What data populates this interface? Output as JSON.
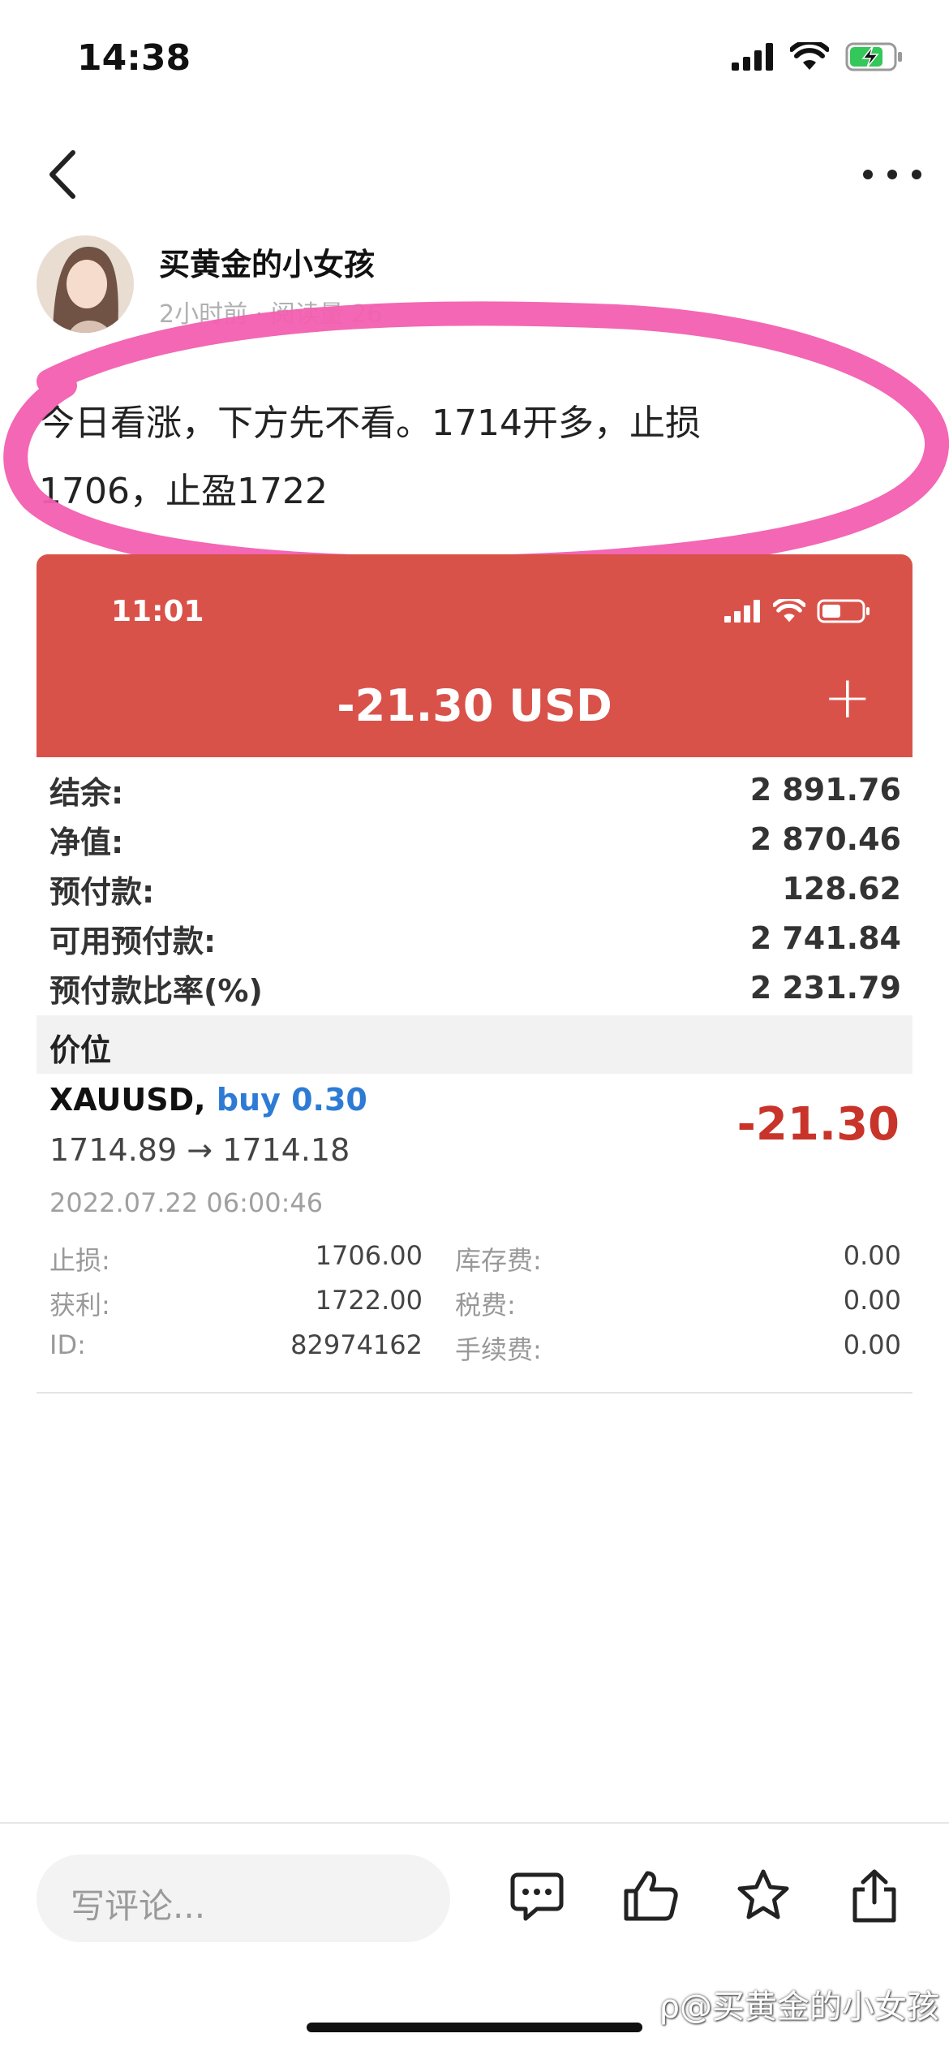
{
  "status_bar": {
    "time": "14:38"
  },
  "author": {
    "name": "买黄金的小女孩",
    "meta": "2小时前 · 阅读量 26"
  },
  "post": {
    "line1": "今日看涨，下方先不看。1714开多，止损",
    "line2": "1706，止盈1722"
  },
  "trade_screenshot": {
    "status_time": "11:01",
    "header_total": "-21.30 USD",
    "plus_label": "+",
    "account": [
      {
        "label": "结余:",
        "value": "2 891.76"
      },
      {
        "label": "净值:",
        "value": "2 870.46"
      },
      {
        "label": "预付款:",
        "value": "128.62"
      },
      {
        "label": "可用预付款:",
        "value": "2 741.84"
      },
      {
        "label": "预付款比率(%)",
        "value": "2 231.79"
      }
    ],
    "section_label": "价位",
    "position": {
      "symbol": "XAUUSD,",
      "side": "buy 0.30",
      "prices": "1714.89 → 1714.18",
      "pl": "-21.30",
      "time": "2022.07.22 06:00:46",
      "details": [
        {
          "k1": "止损:",
          "v1": "1706.00",
          "k2": "库存费:",
          "v2": "0.00"
        },
        {
          "k1": "获利:",
          "v1": "1722.00",
          "k2": "税费:",
          "v2": "0.00"
        },
        {
          "k1": "ID:",
          "v1": "82974162",
          "k2": "手续费:",
          "v2": "0.00"
        }
      ]
    }
  },
  "bottom_bar": {
    "comment_placeholder": "写评论..."
  },
  "watermark": "@买黄金的小女孩",
  "colors": {
    "header_red": "#d9524a",
    "loss_red": "#c8342a",
    "buy_blue": "#2d7bd4",
    "highlight_pink": "#f25fb0"
  }
}
